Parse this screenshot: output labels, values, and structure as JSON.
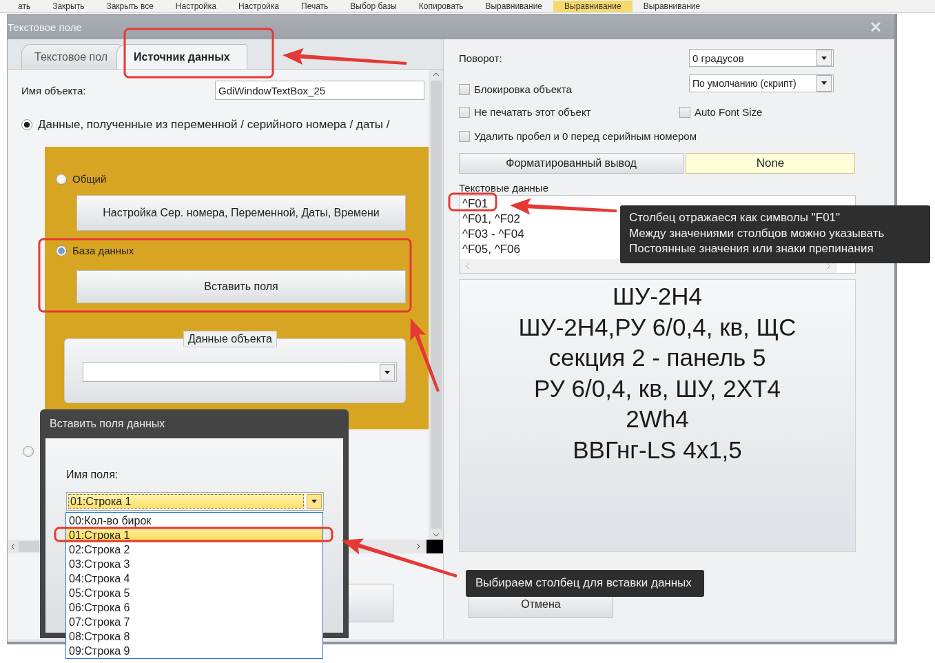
{
  "toolbar": {
    "items": [
      {
        "label": "ать",
        "selected": false
      },
      {
        "label": "Закрыть",
        "selected": false
      },
      {
        "label": "Закрыть все",
        "selected": false
      },
      {
        "label": "Настройка",
        "selected": false
      },
      {
        "label": "Настройка",
        "selected": false
      },
      {
        "label": "Печать",
        "selected": false
      },
      {
        "label": "Выбор базы",
        "selected": false
      },
      {
        "label": "Копировать",
        "selected": false
      },
      {
        "label": "Выравнивание",
        "selected": false
      },
      {
        "label": "Выравнивание",
        "selected": true
      },
      {
        "label": "Выравнивание",
        "selected": false
      }
    ]
  },
  "window": {
    "title": "Текстовое поле"
  },
  "tabs": [
    {
      "label": "Текстовое пол",
      "selected": false
    },
    {
      "label": "Источник данных",
      "selected": true
    }
  ],
  "left": {
    "object_name_label": "Имя объекта:",
    "object_name_value": "GdiWindowTextBox_25",
    "source_radio": {
      "label": "Данные, полученные из переменной / серийного номера / даты /",
      "selected": true
    },
    "general_radio": {
      "label": "Общий",
      "selected": false
    },
    "serial_button": "Настройка Сер. номера, Переменной, Даты, Времени",
    "database_radio": {
      "label": "База данных",
      "selected": true
    },
    "insert_button": "Вставить поля",
    "object_data_group": "Данные объекта",
    "other_radio": {
      "selected": false
    }
  },
  "right": {
    "rotation_label": "Поворот:",
    "rotation_value": "0 градусов",
    "script_value": "По умолчанию (скрипт)",
    "checkboxes": [
      {
        "label": "Блокировка объекта",
        "checked": false
      },
      {
        "label": "Не печатать этот объект",
        "checked": false
      },
      {
        "label": "Auto Font Size",
        "checked": false
      },
      {
        "label": "Удалить пробел и 0 перед серийным номером",
        "checked": false
      }
    ],
    "format_button": "Форматированный вывод",
    "format_value": "None",
    "text_data_label": "Текстовые данные",
    "text_data_lines": [
      "^F01",
      "^F01, ^F02",
      "^F03 - ^F04",
      "^F05, ^F06"
    ],
    "preview_lines": [
      "ШУ-2Н4",
      "ШУ-2Н4,РУ 6/0,4, кв, ЩС",
      "секция 2 - панель 5",
      "РУ 6/0,4, кв, ШУ, 2ХТ4",
      "2Wh4",
      "ВВГнг-LS 4x1,5"
    ],
    "cancel_button": "Отмена"
  },
  "insert_dialog": {
    "title": "Вставить поля данных",
    "field_label": "Имя поля:",
    "field_value": "01:Строка 1",
    "options": [
      {
        "label": "00:Кол-во бирок",
        "selected": false
      },
      {
        "label": "01:Строка 1",
        "selected": true
      },
      {
        "label": "02:Строка 2",
        "selected": false
      },
      {
        "label": "03:Строка 3",
        "selected": false
      },
      {
        "label": "04:Строка 4",
        "selected": false
      },
      {
        "label": "05:Строка 5",
        "selected": false
      },
      {
        "label": "06:Строка 6",
        "selected": false
      },
      {
        "label": "07:Строка 7",
        "selected": false
      },
      {
        "label": "08:Строка 8",
        "selected": false
      },
      {
        "label": "09:Строка 9",
        "selected": false
      }
    ]
  },
  "callouts": [
    {
      "lines": [
        "Столбец отражаеся как символы \"F01\"",
        "Между значениями столбцов можно указывать",
        "Постоянные значения или знаки препинания"
      ]
    },
    {
      "lines": [
        "Выбираем столбец для вставки данных"
      ]
    }
  ]
}
